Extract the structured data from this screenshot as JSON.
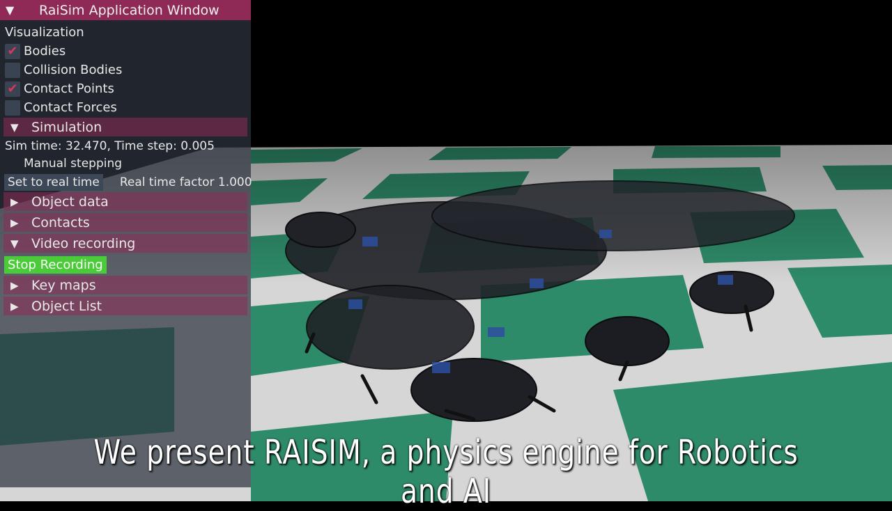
{
  "window": {
    "title": "RaiSim Application Window"
  },
  "visualization": {
    "heading": "Visualization",
    "items": [
      {
        "label": "Bodies",
        "checked": true
      },
      {
        "label": "Collision Bodies",
        "checked": false
      },
      {
        "label": "Contact Points",
        "checked": true
      },
      {
        "label": "Contact Forces",
        "checked": false
      }
    ]
  },
  "simulation": {
    "header": "Simulation",
    "sim_time_text": "Sim time:   32.470, Time step:   0.005",
    "manual_stepping": "Manual stepping",
    "set_real_time_button": "Set to real time",
    "real_time_factor": "Real time factor 1.000"
  },
  "sections": {
    "object_data": "Object data",
    "contacts": "Contacts",
    "video_recording": "Video recording",
    "key_maps": "Key maps",
    "object_list": "Object List"
  },
  "video": {
    "stop_button": "Stop Recording"
  },
  "caption": "We present RAISIM, a physics engine for Robotics and AI",
  "colors": {
    "accent": "#8e2a55",
    "check": "#d9365f",
    "stop_button": "#4ccb3a",
    "floor_green": "#2e8b69",
    "floor_white": "#d9d9d9"
  }
}
